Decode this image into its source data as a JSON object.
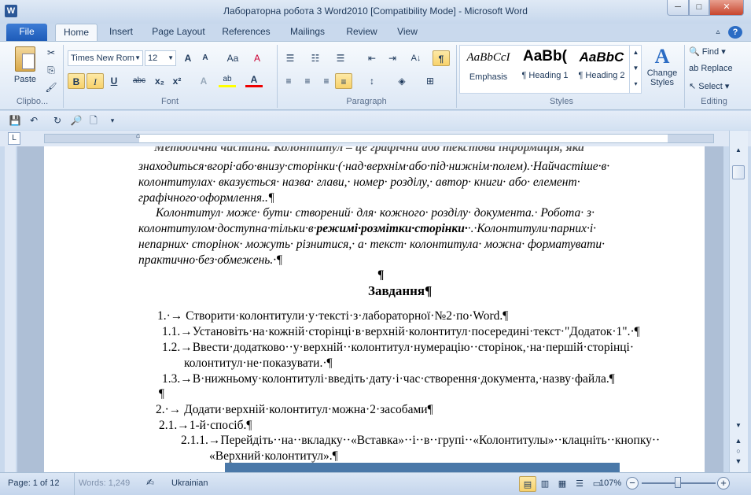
{
  "window": {
    "title": "Лабораторна робота 3 Word2010 [Compatibility Mode]  -  Microsoft Word",
    "app_icon": "W",
    "min": "─",
    "max": "□",
    "close": "✕"
  },
  "tabs": [
    "File",
    "Home",
    "Insert",
    "Page Layout",
    "References",
    "Mailings",
    "Review",
    "View"
  ],
  "ribbon": {
    "clipboard": {
      "paste": "Paste",
      "label": "Clipbo...",
      "cut": "✂",
      "copy": "⎘",
      "format_painter": "🖌"
    },
    "font": {
      "name": "Times New Rom",
      "size": "12",
      "grow": "A",
      "shrink": "A",
      "case": "Aa",
      "clear": "A",
      "bold": "B",
      "italic": "I",
      "underline": "U",
      "strike": "abc",
      "sub": "x₂",
      "sup": "x²",
      "effects": "A",
      "highlight": "ab",
      "color": "A",
      "label": "Font"
    },
    "paragraph": {
      "show_marks": "¶",
      "label": "Paragraph"
    },
    "styles": {
      "items": [
        {
          "preview": "AaBbCcI",
          "name": "Emphasis"
        },
        {
          "preview": "AaBb(",
          "name": "¶ Heading 1"
        },
        {
          "preview": "AaBbC",
          "name": "¶ Heading 2"
        }
      ],
      "change": "Change Styles",
      "label": "Styles"
    },
    "editing": {
      "find": "Find",
      "replace": "Replace",
      "select": "Select",
      "label": "Editing"
    }
  },
  "doc": {
    "p1_line0": "Методична частина. Колонтитул – це графічна або текстова інформація, яка",
    "p1_line1": "знаходиться·вгорі·або·внизу·сторінки·(·над·верхнім·або·під·нижнім·полем).·Найчастіше·в·",
    "p1_line2": "колонтитулах·  вказується·  назва·  глави,·  номер·  розділу,·  автор·  книги·  або·  елемент·",
    "p1_line3": "графічного·оформлення..¶",
    "p2_line1a": "Колонтитул·  може·  бути·  створений·  для·  кожного·  розділу·  документа.·  Робота·  з·",
    "p2_line2a": "колонтитулом·доступна·тільки·в·",
    "p2_line2b": "режимі·розмітки·сторінки·",
    "p2_line2c": "·.·Колонтитули·парних·і·",
    "p2_line3": "непарних·  сторінок·  можуть·  різнитися,·  а·  текст·  колонтитула·  можна·  форматувати·",
    "p2_line4": "практично·без·обмежень.·¶",
    "pilcrow": "¶",
    "heading": "Завдання¶",
    "l1": "1.·→ Створити·колонтитули·у·тексті·з·лабораторної·№2·по·Word.¶",
    "l11": "1.1.→Установіть·на·кожній·сторінці·в·верхній·колонтитул·посередині·текст·\"Додаток·1\".·¶",
    "l12a": "1.2.→Ввести·додатково··у·верхній··колонтитул·нумерацію··сторінок,·на·першій·сторінці·",
    "l12b": "колонтитул·не·показувати.·¶",
    "l13": "1.3.→В·нижньому·колонтитулі·введіть·дату·і·час·створення·документа,·назву·файла.¶",
    "empty": "¶",
    "l2": "2.·→ Додати·верхній·колонтитул·можна·2·засобами¶",
    "l21": "2.1.→1-й·спосіб.¶",
    "l211a": "2.1.1.→Перейдіть··на··вкладку··«Вставка»··і··в··групі··«Колонтитулы»··клацніть··кнопку··",
    "l211b": "«Верхний·колонтитул».¶"
  },
  "status": {
    "page": "Page: 1 of 12",
    "words": "Words: 1,249",
    "lang": "Ukrainian",
    "zoom": "107%",
    "minus": "−",
    "plus": "+"
  }
}
